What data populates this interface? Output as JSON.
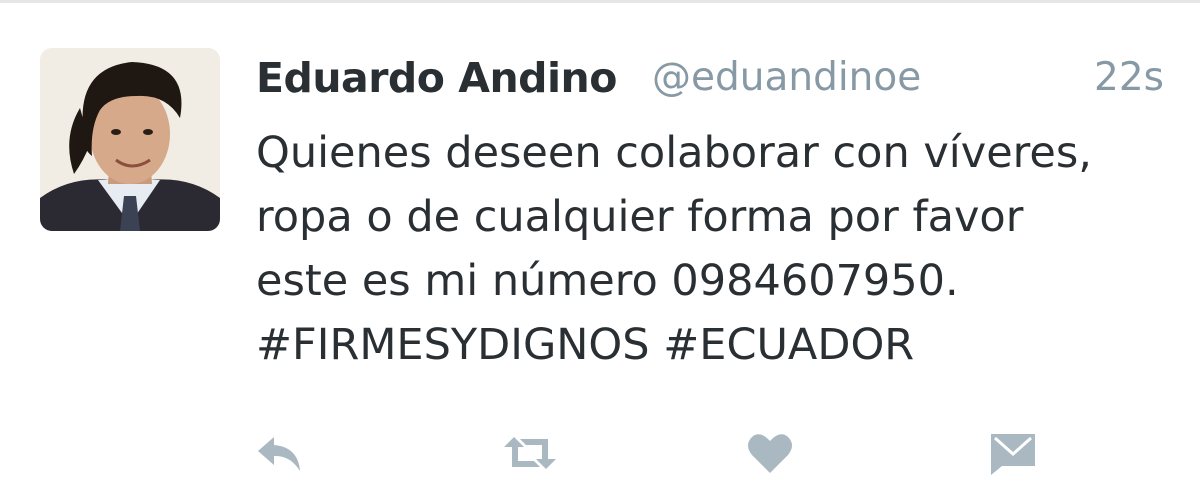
{
  "tweet": {
    "display_name": "Eduardo Andino",
    "handle": "@eduandinoe",
    "timestamp": "22s",
    "text_lines": [
      "Quienes deseen colaborar con víveres,",
      "ropa o de cualquier forma por favor",
      "este es mi número 0984607950.",
      "#FIRMESYDIGNOS #ECUADOR"
    ]
  },
  "actions": {
    "reply_icon": "reply-icon",
    "retweet_icon": "retweet-icon",
    "like_icon": "heart-icon",
    "dm_icon": "envelope-icon"
  },
  "colors": {
    "name": "#292f33",
    "secondary": "#8899a6",
    "icon": "#aab8c2",
    "divider": "#e6e6e6"
  }
}
